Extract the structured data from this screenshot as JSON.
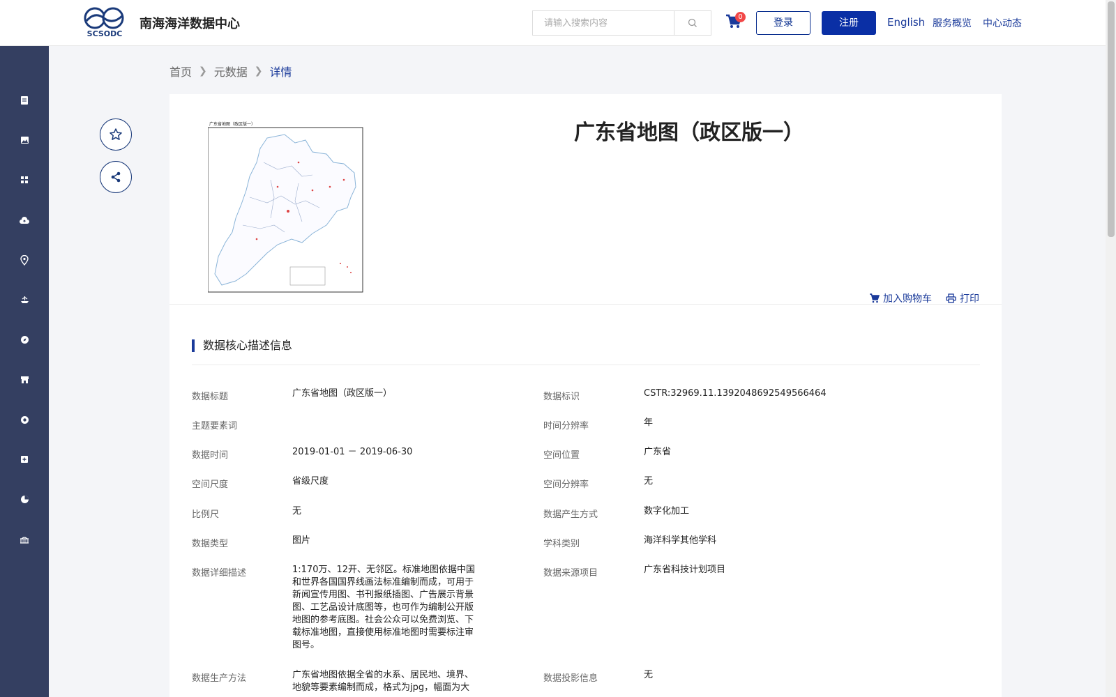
{
  "header": {
    "site_title": "南海海洋数据中心",
    "logo_text": "SCSODC",
    "search_placeholder": "请输入搜索内容",
    "cart_count": "0",
    "login_label": "登录",
    "register_label": "注册",
    "nav": [
      "English",
      "服务概览",
      "中心动态"
    ]
  },
  "breadcrumb": [
    "首页",
    "元数据",
    "详情"
  ],
  "detail": {
    "title": "广东省地图（政区版一）",
    "map_caption": "广东省地图（政区版一）",
    "add_cart_label": "加入购物车",
    "print_label": "打印"
  },
  "section": {
    "title": "数据核心描述信息"
  },
  "fields": {
    "l1_label": "数据标题",
    "l1_value": "广东省地图（政区版一）",
    "r1_label": "数据标识",
    "r1_value": "CSTR:32969.11.1392048692549566464",
    "l2_label": "主题要素词",
    "l2_value": "",
    "r2_label": "时间分辨率",
    "r2_value": "年",
    "l3_label": "数据时间",
    "l3_value": "2019-01-01 － 2019-06-30",
    "r3_label": "空间位置",
    "r3_value": "广东省",
    "l4_label": "空间尺度",
    "l4_value": "省级尺度",
    "r4_label": "空间分辨率",
    "r4_value": "无",
    "l5_label": "比例尺",
    "l5_value": "无",
    "r5_label": "数据产生方式",
    "r5_value": "数字化加工",
    "l6_label": "数据类型",
    "l6_value": "图片",
    "r6_label": "学科类别",
    "r6_value": "海洋科学其他学科",
    "l7_label": "数据详细描述",
    "l7_lines": [
      "1:170万、12开、无邻区。标准地图依据中国",
      "和世界各国国界线画法标准编制而成，可用于",
      "新闻宣传用图、书刊报纸插图、广告展示背景",
      "图、工艺品设计底图等，也可作为编制公开版",
      "地图的参考底图。社会公众可以免费浏览、下",
      "载标准地图，直接使用标准地图时需要标注审",
      "图号。"
    ],
    "r7_label": "数据来源项目",
    "r7_value": "广东省科技计划项目",
    "l8_label": "数据生产方法",
    "l8_lines": [
      "广东省地图依据全省的水系、居民地、境界、",
      "地貌等要素编制而成，格式为jpg，幅面为大"
    ],
    "r8_label": "数据投影信息",
    "r8_value": "无"
  },
  "sidebar_icons": [
    "document-icon",
    "image-icon",
    "grid-icon",
    "cloud-upload-icon",
    "location-pin-icon",
    "ship-icon",
    "compass-icon",
    "store-icon",
    "globe-icon",
    "add-box-icon",
    "pie-chart-icon",
    "bridge-icon"
  ],
  "colors": {
    "primary": "#0a2fa5",
    "sidebar": "#343f61",
    "accent_text": "#1a3a9a",
    "badge": "#f24848"
  }
}
